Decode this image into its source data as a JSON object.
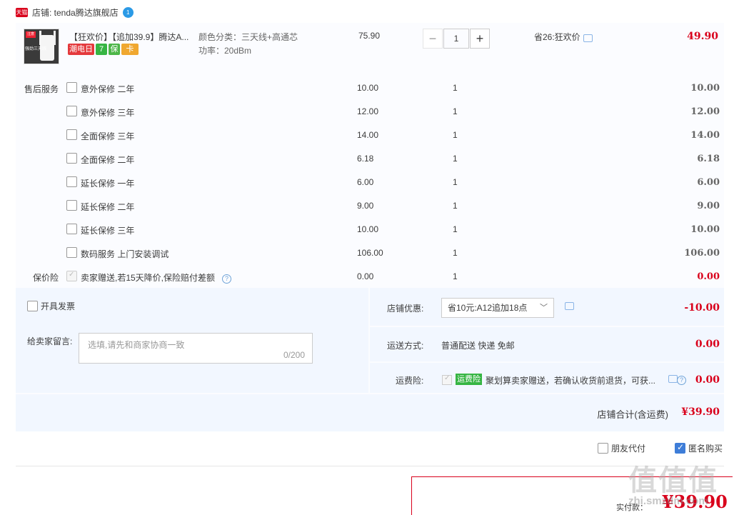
{
  "shop": {
    "badge": "天猫",
    "name": "店铺: tenda腾达旗舰店",
    "wangwang_badge": "1"
  },
  "item": {
    "thumb_tag": "注意",
    "thumb_text": "强劲三天线",
    "title": "【狂欢价】【追加39.9】腾达A...",
    "tags": [
      "潮电日",
      "7",
      "保",
      "卡"
    ],
    "sku_color": "颜色分类：三天线+高通芯",
    "sku_power": "功率：20dBm",
    "price": "75.90",
    "qty": "1",
    "minus": "−",
    "plus": "+",
    "promo": "省26:狂欢价",
    "subtotal": "49.90"
  },
  "services": {
    "label_after_sales": "售后服务",
    "label_price_protect": "保价险",
    "rows": [
      {
        "name": "意外保修 二年",
        "price": "10.00",
        "qty": "1",
        "amount": "10.00"
      },
      {
        "name": "意外保修 三年",
        "price": "12.00",
        "qty": "1",
        "amount": "12.00"
      },
      {
        "name": "全面保修 三年",
        "price": "14.00",
        "qty": "1",
        "amount": "14.00"
      },
      {
        "name": "全面保修 二年",
        "price": "6.18",
        "qty": "1",
        "amount": "6.18"
      },
      {
        "name": "延长保修 一年",
        "price": "6.00",
        "qty": "1",
        "amount": "6.00"
      },
      {
        "name": "延长保修 二年",
        "price": "9.00",
        "qty": "1",
        "amount": "9.00"
      },
      {
        "name": "延长保修 三年",
        "price": "10.00",
        "qty": "1",
        "amount": "10.00"
      },
      {
        "name": "数码服务 上门安装调试",
        "price": "106.00",
        "qty": "1",
        "amount": "106.00"
      },
      {
        "name": "卖家赠送,若15天降价,保险赔付差额",
        "price": "0.00",
        "qty": "1",
        "amount": "0.00"
      }
    ],
    "help": "?"
  },
  "invoice": {
    "label": "开具发票"
  },
  "message": {
    "label": "给卖家留言:",
    "placeholder": "选填,请先和商家协商一致",
    "count": "0/200"
  },
  "coupon": {
    "label": "店铺优惠:",
    "selected": "省10元:A12追加18点",
    "amount": "-10.00"
  },
  "shipping": {
    "label": "运送方式:",
    "method": "普通配送 快递 免邮",
    "amount": "0.00"
  },
  "freight_ins": {
    "label": "运费险:",
    "badge": "运费险",
    "text": "聚划算卖家赠送，若确认收货前退货，可获...",
    "amount": "0.00"
  },
  "total": {
    "label": "店铺合计(含运费)",
    "amount": "¥39.90"
  },
  "options": {
    "friend_pay": "朋友代付",
    "anonymous": "匿名购买"
  },
  "pay": {
    "label": "实付款：",
    "amount": "¥39.90"
  },
  "watermark": {
    "logo": "值值值",
    "site": "zhi.smzdm.com"
  },
  "colors": {
    "accent_red": "#d9001b",
    "panel_blue": "#f2f7ff",
    "check_blue": "#3e7dd8"
  }
}
